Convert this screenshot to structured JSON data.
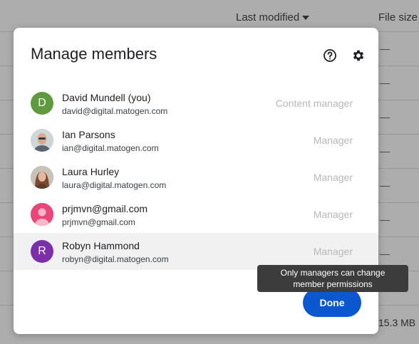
{
  "background": {
    "col_last_modified": "Last modified",
    "col_file_size": "File size",
    "row_placeholder": "—",
    "size_value": "15.3 MB"
  },
  "dialog": {
    "title": "Manage members",
    "help_icon": "help-circle-icon",
    "settings_icon": "gear-icon",
    "done_label": "Done",
    "tooltip": "Only managers can change member permissions"
  },
  "members": [
    {
      "name": "David Mundell (you)",
      "email": "david@digital.matogen.com",
      "role": "Content manager",
      "avatar_letter": "D",
      "avatar_color": "#5f9b3e"
    },
    {
      "name": "Ian Parsons",
      "email": "ian@digital.matogen.com",
      "role": "Manager",
      "avatar_letter": "",
      "avatar_color": "#b9c4c8"
    },
    {
      "name": "Laura Hurley",
      "email": "laura@digital.matogen.com",
      "role": "Manager",
      "avatar_letter": "",
      "avatar_color": "#7a5a4a"
    },
    {
      "name": "prjmvn@gmail.com",
      "email": "prjmvn@gmail.com",
      "role": "Manager",
      "avatar_letter": "",
      "avatar_color": "#e8477a"
    },
    {
      "name": "Robyn Hammond",
      "email": "robyn@digital.matogen.com",
      "role": "Manager",
      "avatar_letter": "R",
      "avatar_color": "#7b2fa8"
    }
  ]
}
